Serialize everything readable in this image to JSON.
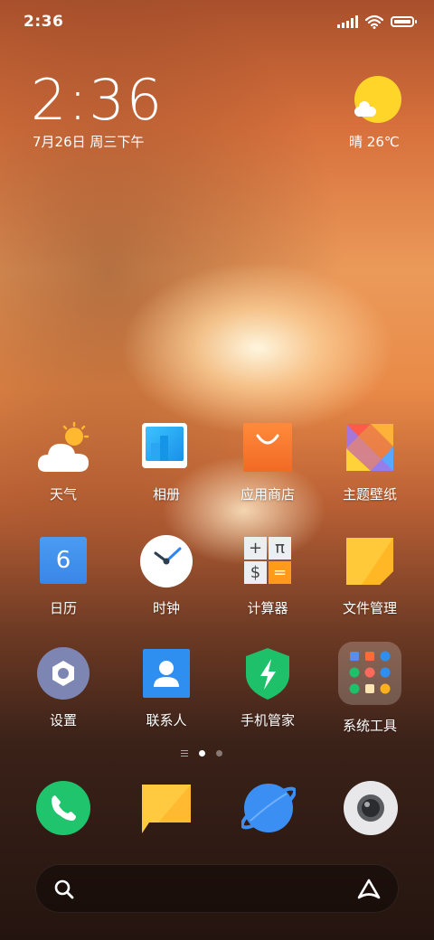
{
  "status_bar": {
    "time": "2:36"
  },
  "clock_widget": {
    "time": "2:36",
    "date": "7月26日 周三下午"
  },
  "weather": {
    "condition": "晴",
    "temperature": "26℃"
  },
  "apps": [
    {
      "label": "天气"
    },
    {
      "label": "相册"
    },
    {
      "label": "应用商店"
    },
    {
      "label": "主题壁纸"
    },
    {
      "label": "日历",
      "badge": "6"
    },
    {
      "label": "时钟"
    },
    {
      "label": "计算器",
      "keys": [
        "+",
        "π",
        "$",
        "="
      ]
    },
    {
      "label": "文件管理"
    },
    {
      "label": "设置"
    },
    {
      "label": "联系人"
    },
    {
      "label": "手机管家"
    },
    {
      "label": "系统工具"
    }
  ],
  "dock": [
    "phone-icon",
    "messages-icon",
    "browser-icon",
    "camera-icon"
  ],
  "page_indicator": {
    "pages": 2,
    "current": 1
  },
  "colors": {
    "phone": "#1fc46c",
    "messages": "#ffc940",
    "browser": "#3b8ff3",
    "weather_sun": "#ffd52a",
    "security": "#1fc06a"
  }
}
